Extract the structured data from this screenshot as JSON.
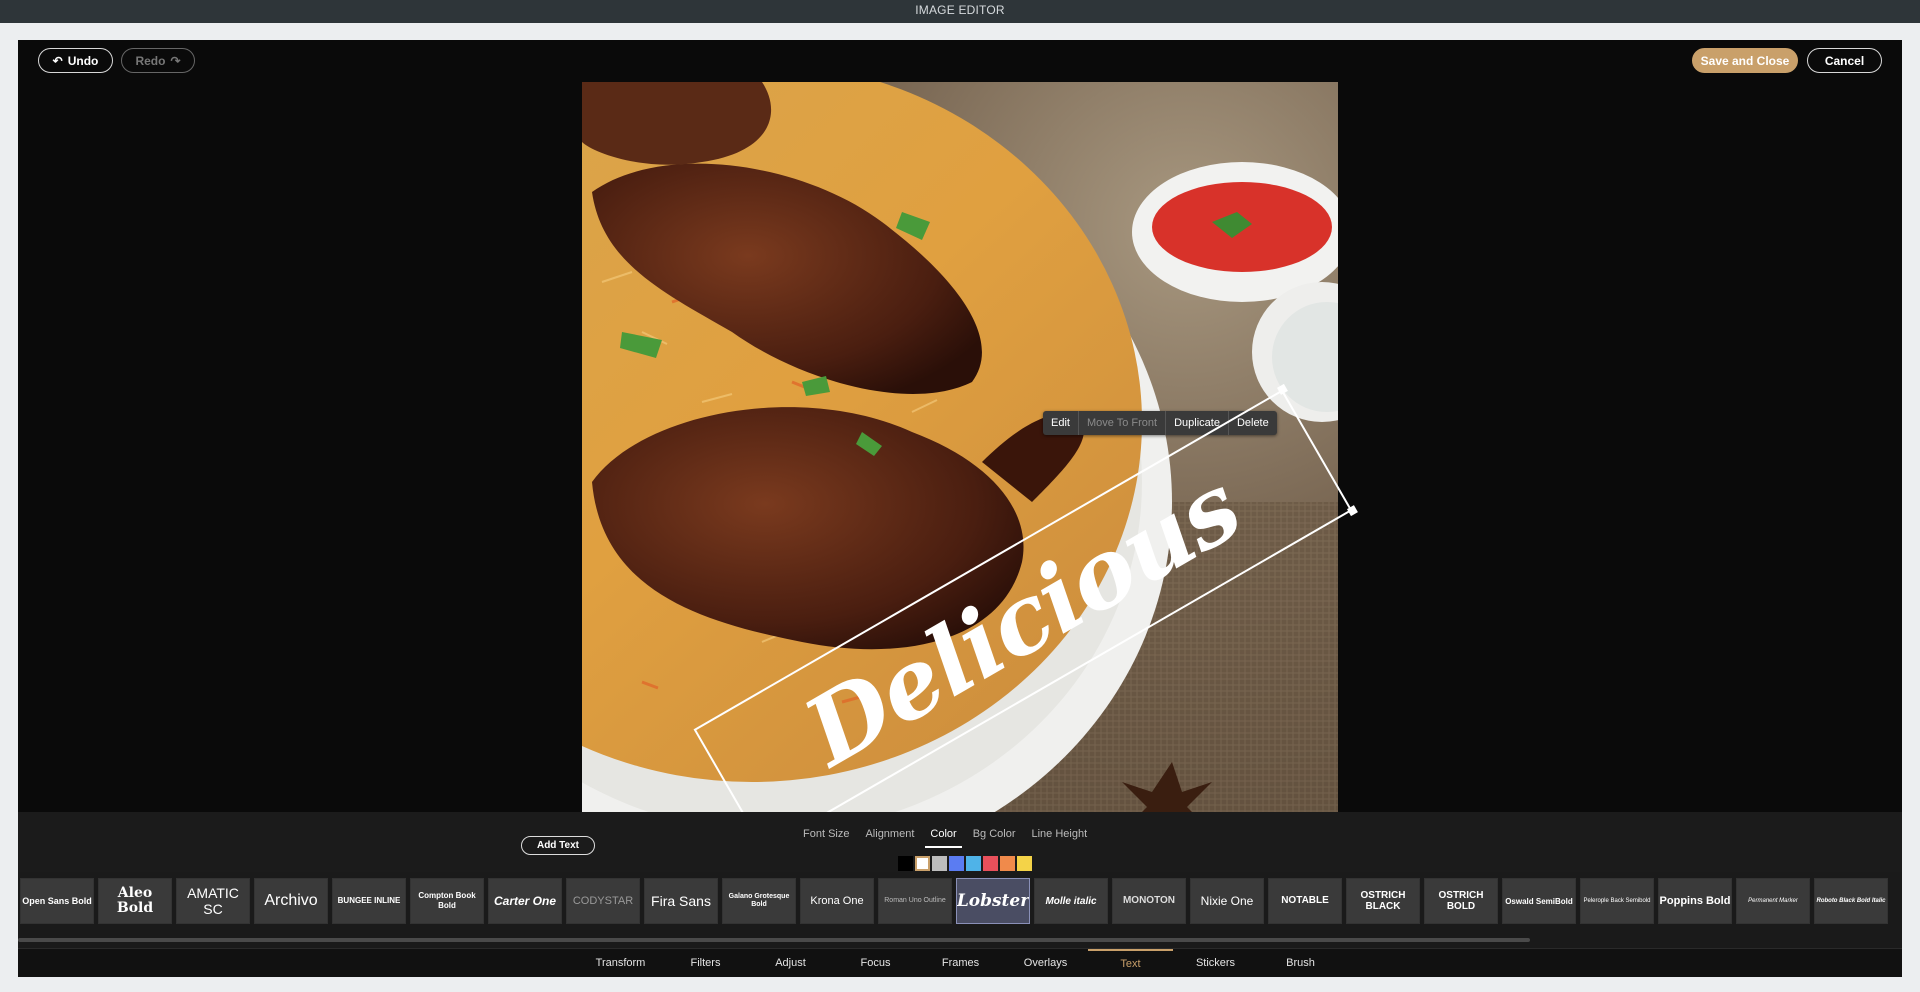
{
  "title": "IMAGE EDITOR",
  "toolbar": {
    "undo_label": "Undo",
    "redo_label": "Redo",
    "save_label": "Save and Close",
    "cancel_label": "Cancel"
  },
  "context_menu": {
    "edit": "Edit",
    "move_to_front": "Move To Front",
    "duplicate": "Duplicate",
    "delete": "Delete"
  },
  "text_object": {
    "text": "Delicious",
    "rotation_deg": -30
  },
  "panel": {
    "add_text_label": "Add Text",
    "subtabs": [
      "Font Size",
      "Alignment",
      "Color",
      "Bg Color",
      "Line Height"
    ],
    "active_subtab": "Color",
    "colors": [
      "#000000",
      "#ffffff",
      "#bdbdbd",
      "#5b7cf2",
      "#4fb3e8",
      "#e8505b",
      "#f08a4b",
      "#f4d348"
    ],
    "selected_color": "#ffffff",
    "fonts": [
      "Open Sans Bold",
      "Aleo Bold",
      "AMATIC SC",
      "Archivo",
      "BUNGEE INLINE",
      "Compton Book Bold",
      "Carter One",
      "CODYSTAR",
      "Fira Sans",
      "Galano Grotesque Bold",
      "Krona One",
      "Roman Uno Outline",
      "Lobster",
      "Molle italic",
      "MONOTON",
      "Nixie One",
      "NOTABLE",
      "OSTRICH BLACK",
      "OSTRICH BOLD",
      "Oswald SemiBold",
      "Pelerople Back Semibold",
      "Poppins Bold",
      "Permanent Marker",
      "Roboto Black Bold Italic"
    ],
    "active_font": "Lobster"
  },
  "main_tabs": [
    "Transform",
    "Filters",
    "Adjust",
    "Focus",
    "Frames",
    "Overlays",
    "Text",
    "Stickers",
    "Brush"
  ],
  "active_main_tab": "Text"
}
